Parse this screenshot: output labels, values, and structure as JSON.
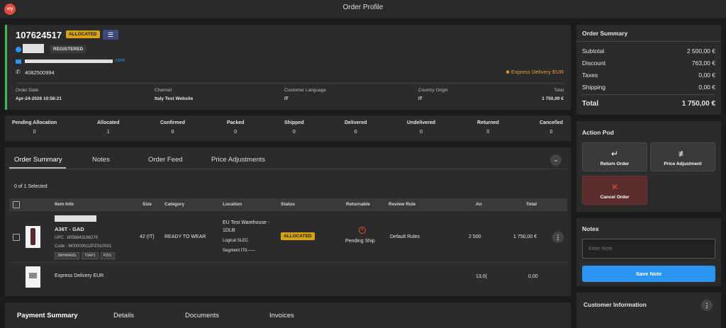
{
  "app": {
    "logo": "x/y",
    "title": "Order Profile"
  },
  "order": {
    "number": "107624517",
    "status_badge": "ALLOCATED",
    "customer_badge": "REGISTERED",
    "email_suffix": ".com",
    "phone": "4082500994",
    "delivery": "Express Delivery EUR",
    "order_date_label": "Order Date",
    "order_date": "Apr-24-2026 10:56:21",
    "channel_label": "Channel",
    "channel": "Italy Test Website",
    "language_label": "Customer Language",
    "language": "IT",
    "origin_label": "Country Origin",
    "origin": "IT",
    "total_label": "Total",
    "total": "1 750,00 €"
  },
  "status_counts": [
    {
      "label": "Pending Allocation",
      "value": "0"
    },
    {
      "label": "Allocated",
      "value": "1"
    },
    {
      "label": "Confirmed",
      "value": "0"
    },
    {
      "label": "Packed",
      "value": "0"
    },
    {
      "label": "Shipped",
      "value": "0"
    },
    {
      "label": "Delivered",
      "value": "0"
    },
    {
      "label": "Undelivered",
      "value": "0"
    },
    {
      "label": "Returned",
      "value": "0"
    },
    {
      "label": "Cancelled",
      "value": "0"
    }
  ],
  "tabs": {
    "summary": "Order Summary",
    "notes": "Notes",
    "feed": "Order Feed",
    "price": "Price Adjustments"
  },
  "selection": "0 of 1 Selected",
  "columns": {
    "item": "Item Info",
    "size": "Size",
    "category": "Category",
    "location": "Location",
    "status": "Status",
    "returnable": "Returnable",
    "review": "Review Rule",
    "amount": "An",
    "total": "Total"
  },
  "item": {
    "name": "A36T - GAD",
    "upc": "UPC : 8056643186276",
    "code": "Code : M00000N12PZ010S01",
    "tags": [
      "3WHWA80L",
      "T0AP1",
      "PZ01"
    ],
    "size": "42 (IT)",
    "category": "READY TO WEAR",
    "location": "EU Test Warehouse - 1DLB",
    "logical": "Logical SLEC",
    "segment": "Segment IT0------",
    "status": "ALLOCATED",
    "returnable": "Pending Ship",
    "review": "Default Rules",
    "amount": "2 500",
    "total": "1 750,00 €"
  },
  "shipping_row": {
    "name": "Express Delivery EUR",
    "amount": "13,0(",
    "total": "0,00"
  },
  "bottom_tabs": {
    "payment": "Payment Summary",
    "details": "Details",
    "documents": "Documents",
    "invoices": "Invoices"
  },
  "summary": {
    "title": "Order Summary",
    "subtotal_label": "Subtotal",
    "subtotal": "2 500,00 €",
    "discount_label": "Discount",
    "discount": "763,00 €",
    "taxes_label": "Taxes",
    "taxes": "0,00 €",
    "shipping_label": "Shipping",
    "shipping": "0,00 €",
    "total_label": "Total",
    "total": "1 750,00 €"
  },
  "action_pod": {
    "title": "Action Pod",
    "return": "Return Order",
    "price": "Price Adjustment",
    "cancel": "Cancel Order"
  },
  "notes": {
    "title": "Notes",
    "placeholder": "Enter Note",
    "save": "Save Note"
  },
  "customer_info": {
    "title": "Customer Information"
  },
  "colors": {
    "accent": "#2b93f0",
    "allocated": "#d6a511",
    "danger": "#e24a3b",
    "green": "#32c24d"
  }
}
